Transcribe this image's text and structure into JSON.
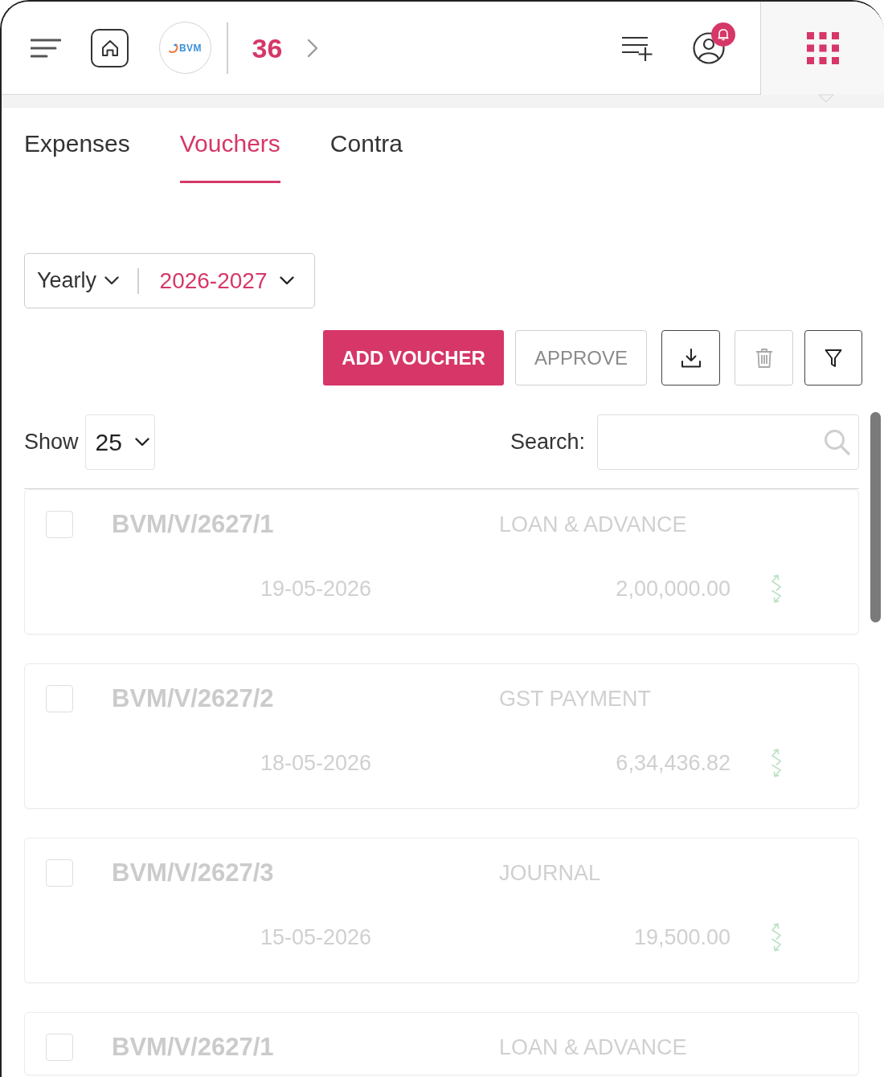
{
  "header": {
    "logo_text": "BVM",
    "count": "36"
  },
  "tabs": [
    {
      "label": "Expenses",
      "selected": false
    },
    {
      "label": "Vouchers",
      "selected": true
    },
    {
      "label": "Contra",
      "selected": false
    }
  ],
  "period": {
    "mode": "Yearly",
    "year": "2026-2027"
  },
  "toolbar": {
    "add_button": {
      "label": "ADD VOUCHER"
    },
    "approve_button": {
      "label": "APPROVE",
      "disabled": true
    },
    "download_button": {
      "disabled": false
    },
    "delete_button": {
      "disabled": true
    },
    "filter_button": {
      "disabled": false
    }
  },
  "list_controls": {
    "show_label": "Show",
    "page_size": "25",
    "search_label": "Search:"
  },
  "vouchers": [
    {
      "number": "BVM/V/2627/1",
      "type": "LOAN & ADVANCE",
      "date": "19-05-2026",
      "amount": "2,00,000.00",
      "checked": false
    },
    {
      "number": "BVM/V/2627/2",
      "type": "GST PAYMENT",
      "date": "18-05-2026",
      "amount": "6,34,436.82",
      "checked": false
    },
    {
      "number": "BVM/V/2627/3",
      "type": "JOURNAL",
      "date": "15-05-2026",
      "amount": "19,500.00",
      "checked": false
    },
    {
      "number": "BVM/V/2627/1",
      "type": "LOAN & ADVANCE",
      "checked": false
    }
  ]
}
